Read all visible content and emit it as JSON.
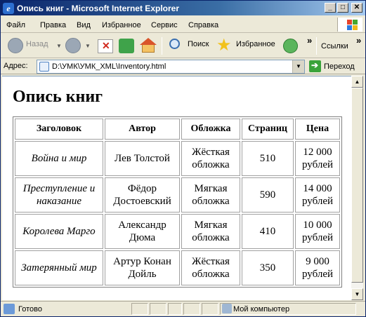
{
  "window": {
    "title": "Опись книг - Microsoft Internet Explorer",
    "buttons": {
      "minimize": "_",
      "maximize": "□",
      "close": "✕"
    }
  },
  "menu": {
    "items": [
      "Файл",
      "Правка",
      "Вид",
      "Избранное",
      "Сервис",
      "Справка"
    ]
  },
  "toolbar": {
    "back_label": "Назад",
    "search_label": "Поиск",
    "favorites_label": "Избранное",
    "chevron": "»",
    "links_label": "Ссылки"
  },
  "address": {
    "label": "Адрес:",
    "value": "D:\\УМК\\УМК_XML\\Inventory.html",
    "go_label": "Переход"
  },
  "page": {
    "title": "Опись книг",
    "columns": [
      "Заголовок",
      "Автор",
      "Обложка",
      "Страниц",
      "Цена"
    ],
    "rows": [
      {
        "title": "Война и мир",
        "author": "Лев Толстой",
        "cover": "Жёсткая обложка",
        "pages": "510",
        "price": "12 000 рублей"
      },
      {
        "title": "Преступление и наказание",
        "author": "Фёдор Достоевский",
        "cover": "Мягкая обложка",
        "pages": "590",
        "price": "14 000 рублей"
      },
      {
        "title": "Королева Марго",
        "author": "Александр Дюма",
        "cover": "Мягкая обложка",
        "pages": "410",
        "price": "10 000 рублей"
      },
      {
        "title": "Затерянный мир",
        "author": "Артур Конан Дойль",
        "cover": "Жёсткая обложка",
        "pages": "350",
        "price": "9 000 рублей"
      }
    ]
  },
  "status": {
    "text": "Готово",
    "zone": "Мой компьютер"
  },
  "colors": {
    "titlebar": "#0a246a",
    "chrome": "#ece9d8"
  }
}
